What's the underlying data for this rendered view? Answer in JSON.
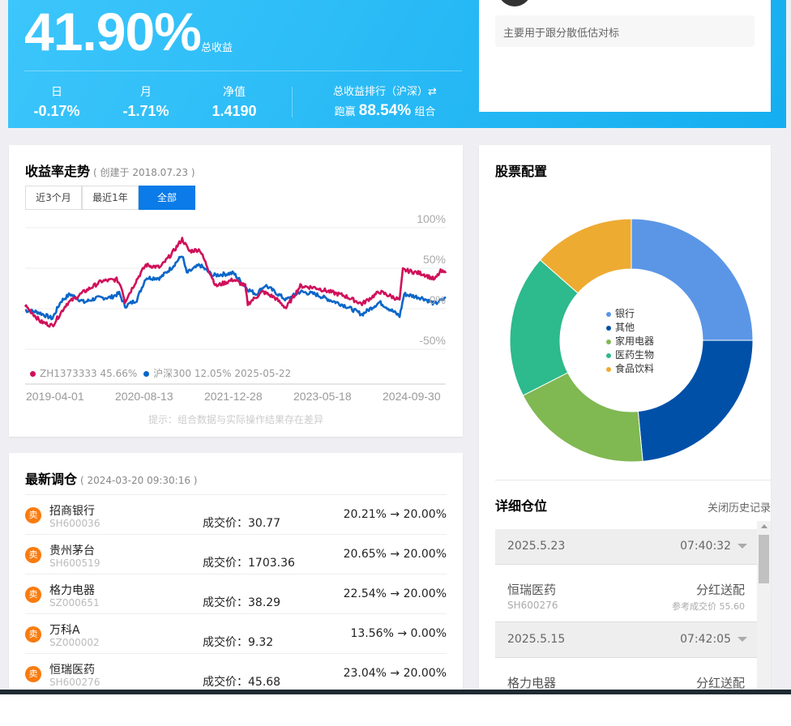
{
  "summary": {
    "total_return": "41.90%",
    "total_return_label": "总收益",
    "stats": [
      {
        "label": "日",
        "value": "-0.17%"
      },
      {
        "label": "月",
        "value": "-1.71%"
      },
      {
        "label": "净值",
        "value": "1.4190"
      }
    ],
    "rank_label": "总收益排行（沪深）⇄",
    "rank_prefix": "跑赢",
    "rank_value": "88.54%",
    "rank_suffix": "组合"
  },
  "description": "主要用于跟分散低估对标",
  "trend": {
    "title": "收益率走势",
    "created": "( 创建于 2018.07.23 )",
    "tabs": [
      "近3个月",
      "最近1年",
      "全部"
    ],
    "active_tab": 2,
    "hint": "提示：组合数据与实际操作结果存在差异"
  },
  "chart_data": {
    "type": "line",
    "title": "收益率走势",
    "ylim": [
      -50,
      100
    ],
    "yticks": [
      "100%",
      "50%",
      "0%",
      "-50%"
    ],
    "xticks": [
      "2019-04-01",
      "2020-08-13",
      "2021-12-28",
      "2023-05-18",
      "2024-09-30"
    ],
    "xlim": [
      2018.75,
      2025.23
    ],
    "legend": {
      "portfolio": "ZH1373333 45.66%",
      "benchmark": "沪深300 12.05% 2025-05-22"
    },
    "series": [
      {
        "name": "ZH1373333",
        "color": "#d0105a",
        "points": [
          [
            2018.75,
            4
          ],
          [
            2018.99,
            -16
          ],
          [
            2019.17,
            -21
          ],
          [
            2019.39,
            6
          ],
          [
            2019.66,
            21
          ],
          [
            2019.93,
            34
          ],
          [
            2020.16,
            36
          ],
          [
            2020.23,
            28
          ],
          [
            2020.29,
            9
          ],
          [
            2020.47,
            36
          ],
          [
            2020.61,
            54
          ],
          [
            2020.83,
            51
          ],
          [
            2021.01,
            68
          ],
          [
            2021.17,
            86
          ],
          [
            2021.28,
            71
          ],
          [
            2021.44,
            73
          ],
          [
            2021.6,
            44
          ],
          [
            2021.69,
            28
          ],
          [
            2021.96,
            36
          ],
          [
            2022.14,
            28
          ],
          [
            2022.18,
            6
          ],
          [
            2022.41,
            21
          ],
          [
            2022.59,
            14
          ],
          [
            2022.77,
            1
          ],
          [
            2022.99,
            28
          ],
          [
            2023.22,
            26
          ],
          [
            2023.44,
            21
          ],
          [
            2023.67,
            16
          ],
          [
            2023.94,
            6
          ],
          [
            2024.21,
            21
          ],
          [
            2024.52,
            11
          ],
          [
            2024.57,
            48
          ],
          [
            2024.88,
            43
          ],
          [
            2025.06,
            36
          ],
          [
            2025.15,
            46
          ],
          [
            2025.23,
            44
          ]
        ]
      },
      {
        "name": "沪深300",
        "color": "#0a66c8",
        "points": [
          [
            2018.75,
            -2
          ],
          [
            2018.94,
            -4
          ],
          [
            2019.17,
            -12
          ],
          [
            2019.3,
            9
          ],
          [
            2019.44,
            18
          ],
          [
            2019.66,
            8
          ],
          [
            2019.84,
            13
          ],
          [
            2020.07,
            14
          ],
          [
            2020.2,
            19
          ],
          [
            2020.29,
            3
          ],
          [
            2020.47,
            11
          ],
          [
            2020.61,
            38
          ],
          [
            2020.83,
            38
          ],
          [
            2021.01,
            51
          ],
          [
            2021.17,
            66
          ],
          [
            2021.24,
            44
          ],
          [
            2021.44,
            54
          ],
          [
            2021.64,
            41
          ],
          [
            2021.96,
            44
          ],
          [
            2022.18,
            24
          ],
          [
            2022.31,
            18
          ],
          [
            2022.45,
            29
          ],
          [
            2022.77,
            11
          ],
          [
            2022.99,
            21
          ],
          [
            2023.22,
            18
          ],
          [
            2023.44,
            11
          ],
          [
            2023.67,
            4
          ],
          [
            2023.94,
            -7
          ],
          [
            2024.21,
            8
          ],
          [
            2024.52,
            -9
          ],
          [
            2024.59,
            18
          ],
          [
            2024.88,
            13
          ],
          [
            2025.06,
            6
          ],
          [
            2025.23,
            13
          ]
        ]
      }
    ]
  },
  "rebalance": {
    "title": "最新调仓",
    "time": "( 2024-03-20 09:30:16 )",
    "price_label": "成交价：",
    "rows": [
      {
        "action": "卖",
        "name": "招商银行",
        "code": "SH600036",
        "price": "30.77",
        "from": "20.21%",
        "to": "20.00%"
      },
      {
        "action": "卖",
        "name": "贵州茅台",
        "code": "SH600519",
        "price": "1703.36",
        "from": "20.65%",
        "to": "20.00%"
      },
      {
        "action": "卖",
        "name": "格力电器",
        "code": "SZ000651",
        "price": "38.29",
        "from": "22.54%",
        "to": "20.00%"
      },
      {
        "action": "卖",
        "name": "万科A",
        "code": "SZ000002",
        "price": "9.32",
        "from": "13.56%",
        "to": "0.00%"
      },
      {
        "action": "卖",
        "name": "恒瑞医药",
        "code": "SH600276",
        "price": "45.68",
        "from": "23.04%",
        "to": "20.00%"
      }
    ]
  },
  "allocation": {
    "title": "股票配置",
    "slices": [
      {
        "label": "银行",
        "value": 25,
        "color": "#5b96e6"
      },
      {
        "label": "其他",
        "value": 23.5,
        "color": "#0050a8"
      },
      {
        "label": "家用电器",
        "value": 19,
        "color": "#80b852"
      },
      {
        "label": "医药生物",
        "value": 19,
        "color": "#2dba8c"
      },
      {
        "label": "食品饮料",
        "value": 13.5,
        "color": "#edab32"
      }
    ]
  },
  "positions": {
    "title": "详细仓位",
    "close_history": "关闭历史记录",
    "records": [
      {
        "date": "2025.5.23",
        "time": "07:40:32",
        "name": "恒瑞医药",
        "code": "SH600276",
        "type": "分红送配",
        "ref": "参考成交价 55.60"
      },
      {
        "date": "2025.5.15",
        "time": "07:42:05",
        "name": "格力电器",
        "type": "分红送配"
      }
    ]
  }
}
